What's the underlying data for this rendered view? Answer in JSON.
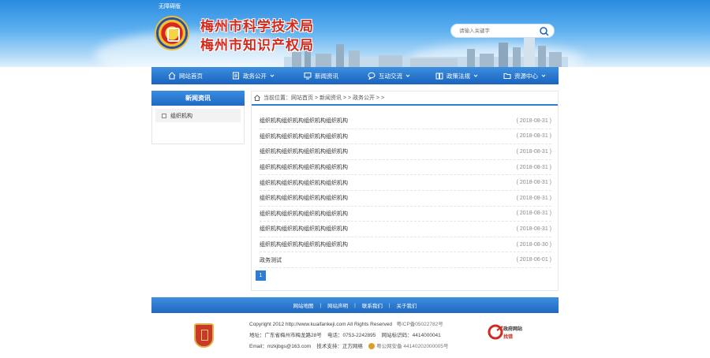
{
  "header": {
    "barrier_free": "无障碍版",
    "title_line1": "梅州市科学技术局",
    "title_line2": "梅州市知识产权局",
    "search_placeholder": "请输入关键字"
  },
  "nav": [
    {
      "label": "网站首页",
      "icon": "home-icon"
    },
    {
      "label": "政务公开",
      "icon": "document-icon"
    },
    {
      "label": "新闻资讯",
      "icon": "monitor-icon"
    },
    {
      "label": "互动交流",
      "icon": "chat-icon"
    },
    {
      "label": "政策法规",
      "icon": "book-icon"
    },
    {
      "label": "资源中心",
      "icon": "folder-icon"
    }
  ],
  "sidebar": {
    "title": "新闻资讯",
    "items": [
      {
        "label": "组织机构"
      }
    ]
  },
  "breadcrumb": {
    "text": "当前位置：网站首页 > 新闻资讯 > > 政务公开 > >"
  },
  "articles": [
    {
      "title": "组织机构组织机构组织机构组织机构",
      "date": "( 2018-08-31 )"
    },
    {
      "title": "组织机构组织机构组织机构组织机构",
      "date": "( 2018-08-31 )"
    },
    {
      "title": "组织机构组织机构组织机构组织机构",
      "date": "( 2018-08-31 )"
    },
    {
      "title": "组织机构组织机构组织机构组织机构",
      "date": "( 2018-08-31 )"
    },
    {
      "title": "组织机构组织机构组织机构组织机构",
      "date": "( 2018-08-31 )"
    },
    {
      "title": "组织机构组织机构组织机构组织机构",
      "date": "( 2018-08-31 )"
    },
    {
      "title": "组织机构组织机构组织机构组织机构",
      "date": "( 2018-08-31 )"
    },
    {
      "title": "组织机构组织机构组织机构组织机构",
      "date": "( 2018-08-31 )"
    },
    {
      "title": "组织机构组织机构组织机构组织机构",
      "date": "( 2018-08-30 )"
    },
    {
      "title": "政务测试",
      "date": "( 2018-06-01 )"
    }
  ],
  "pagination": {
    "current": "1"
  },
  "footer": {
    "links": [
      "网站地图",
      "网站声明",
      "联系我们",
      "关于我们"
    ],
    "copyright": "Copyright 2012 http://www.kuaifankeji.com All Rights Reserved",
    "icp": "粤ICP备05022782号",
    "address": "地址：广东省梅州市梅龙路28号",
    "phone": "电话：0753-2242895",
    "site_id": "网站标识码：4414000041",
    "email": "Email：mzkjbgs@163.com",
    "tech": "技术支持：正方网络",
    "police": "粤公网安备 44140202000005号",
    "gov_logo_line1": "政府网站",
    "gov_logo_line2": "找错"
  }
}
